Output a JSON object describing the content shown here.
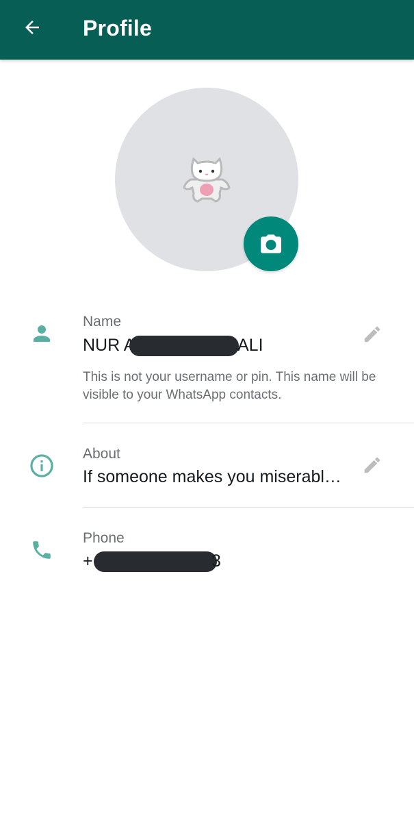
{
  "colors": {
    "header_bg": "#075e55",
    "accent": "#00897b",
    "icon_teal": "#5aafa3",
    "edit_icon": "#bdbdbd"
  },
  "header": {
    "title": "Profile",
    "back_icon": "arrow-left-icon"
  },
  "avatar": {
    "image": "cat-sticker",
    "camera_icon": "camera-icon"
  },
  "name_row": {
    "icon": "person-icon",
    "label": "Name",
    "value_prefix": "NUR A",
    "value_suffix": "ALI",
    "hint": "This is not your username or pin. This name will be visible to your WhatsApp contacts.",
    "edit_icon": "pencil-icon"
  },
  "about_row": {
    "icon": "info-icon",
    "label": "About",
    "value": "If someone makes you miserabl…",
    "edit_icon": "pencil-icon"
  },
  "phone_row": {
    "icon": "phone-icon",
    "label": "Phone",
    "value_prefix": "+",
    "value_suffix": "3"
  }
}
